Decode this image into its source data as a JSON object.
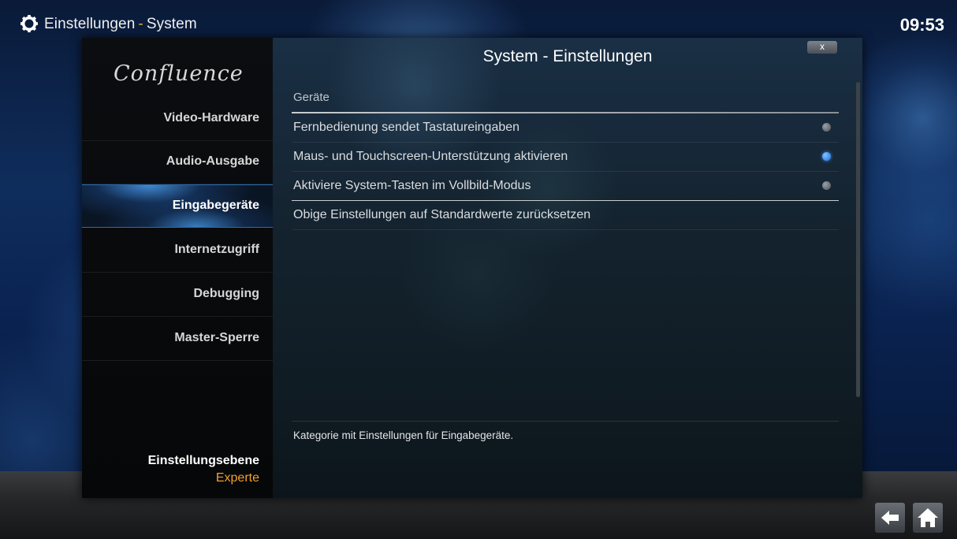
{
  "header": {
    "section": "Einstellungen",
    "separator": "-",
    "page": "System",
    "time": "09:53"
  },
  "sidebar": {
    "logo": "Confluence",
    "items": [
      {
        "label": "Video-Hardware",
        "active": false
      },
      {
        "label": "Audio-Ausgabe",
        "active": false
      },
      {
        "label": "Eingabegeräte",
        "active": true
      },
      {
        "label": "Internetzugriff",
        "active": false
      },
      {
        "label": "Debugging",
        "active": false
      },
      {
        "label": "Master-Sperre",
        "active": false
      }
    ],
    "level_label": "Einstellungsebene",
    "level_value": "Experte"
  },
  "dialog": {
    "title": "System - Einstellungen",
    "close_label": "x",
    "group_header": "Geräte",
    "settings": [
      {
        "label": "Fernbedienung sendet Tastatureingaben",
        "enabled": false
      },
      {
        "label": "Maus- und Touchscreen-Unterstützung aktivieren",
        "enabled": true
      },
      {
        "label": "Aktiviere System-Tasten im Vollbild-Modus",
        "enabled": false
      }
    ],
    "reset_label": "Obige Einstellungen auf Standardwerte zurücksetzen",
    "description": "Kategorie mit Einstellungen für Eingabegeräte."
  },
  "footer": {
    "back_icon": "back-arrow-icon",
    "home_icon": "home-icon"
  },
  "colors": {
    "accent_orange": "#f0a030",
    "active_blue": "#2a6db0",
    "radio_on": "#1c6ee8"
  }
}
